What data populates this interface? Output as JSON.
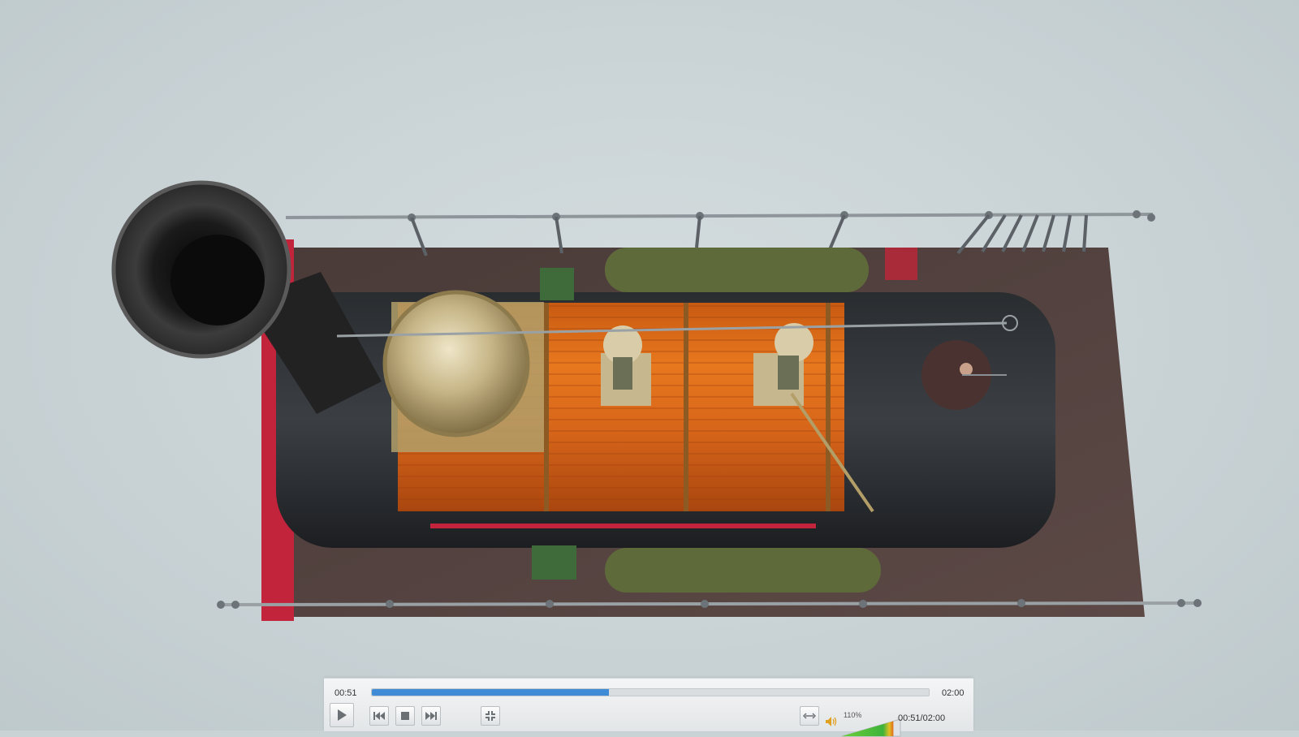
{
  "player": {
    "current_time": "00:51",
    "duration": "02:00",
    "time_readout": "00:51/02:00",
    "progress": 0.425,
    "volume_label": "110%",
    "volume_level": 1.1,
    "accent_color": "#3f8bd6",
    "background_color": "#c9d3d6"
  },
  "buttons": {
    "play": "play-icon",
    "previous": "skip-back-icon",
    "stop": "stop-icon",
    "next": "skip-forward-icon",
    "fullscreen": "exit-fullscreen-icon",
    "aspect": "stretch-icon",
    "volume": "speaker-icon"
  }
}
